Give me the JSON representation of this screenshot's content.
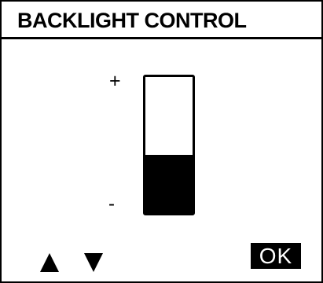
{
  "window": {
    "title": "BACKLIGHT CONTROL"
  },
  "level_control": {
    "max_label": "+",
    "min_label": "-",
    "level_fraction": 0.43,
    "fill_color": "#000000"
  },
  "buttons": {
    "up_icon": "triangle-up-icon",
    "down_icon": "triangle-down-icon",
    "ok_label": "OK"
  }
}
